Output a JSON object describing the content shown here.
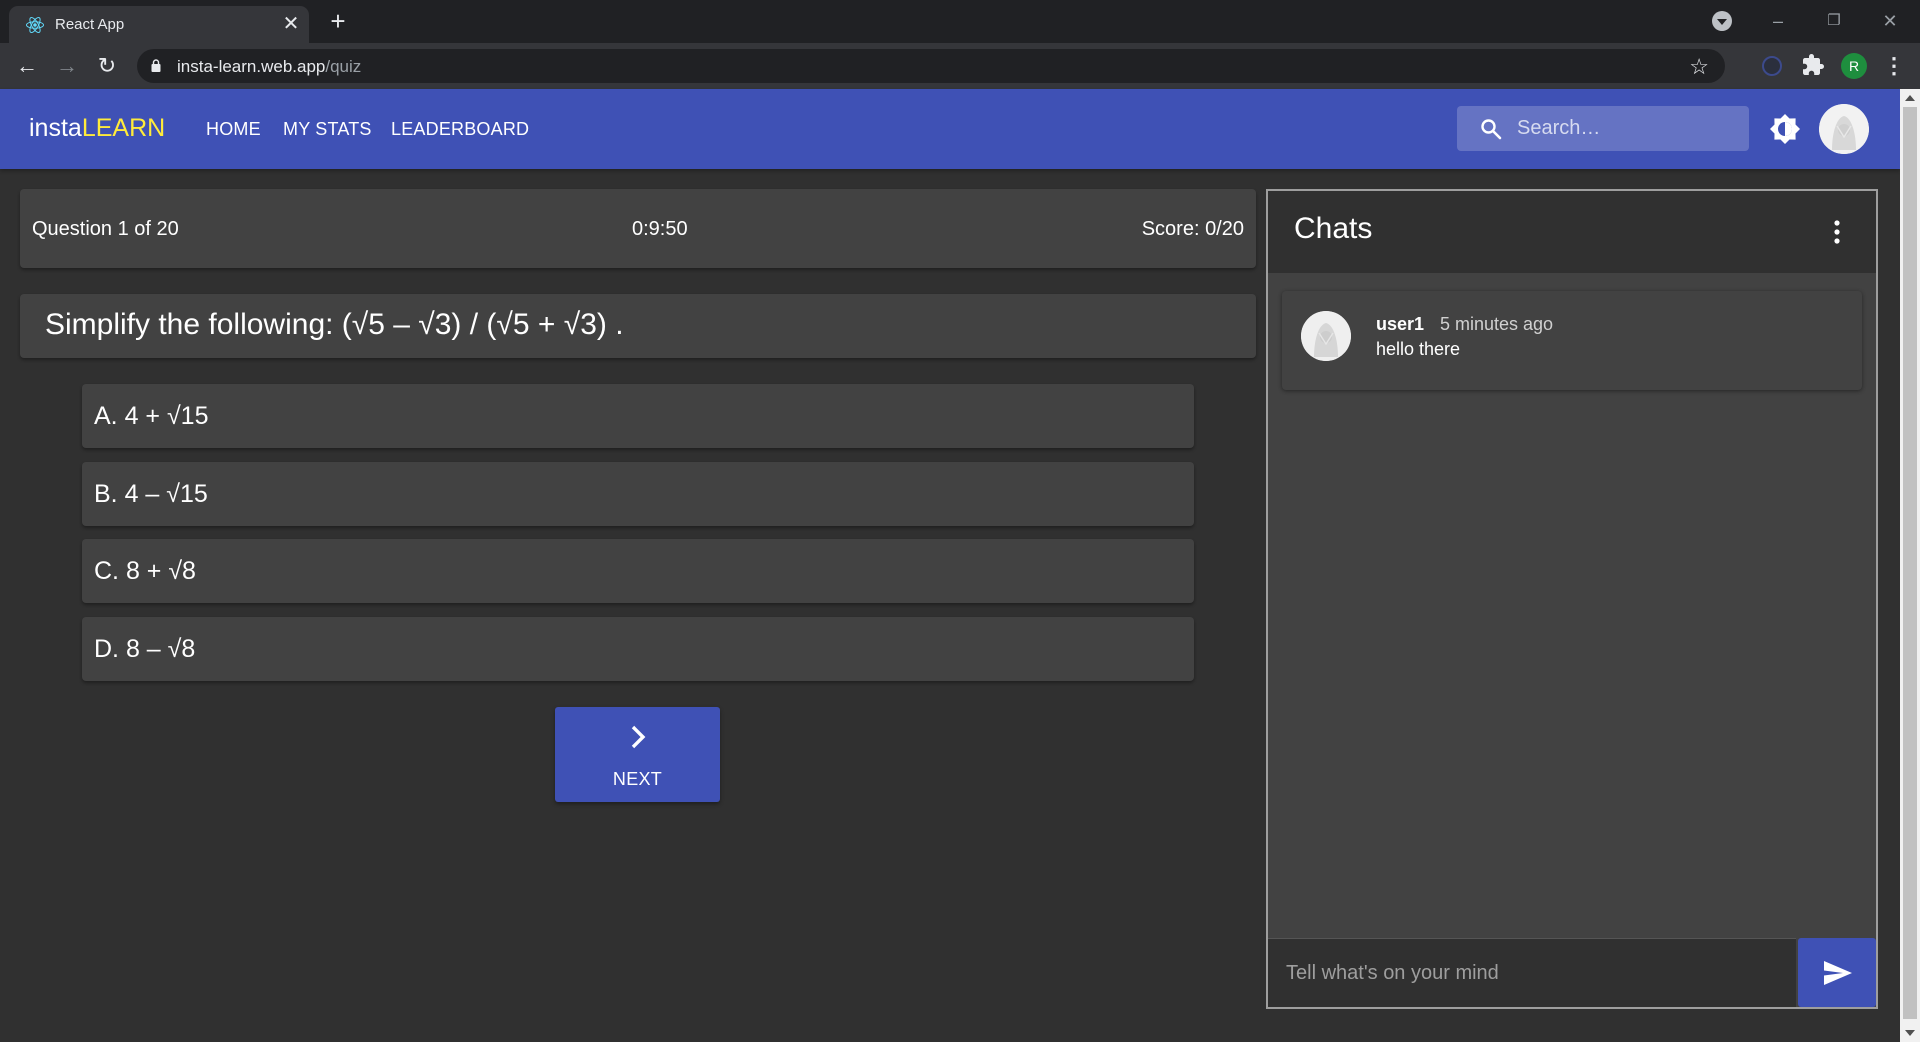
{
  "browser": {
    "tab_title": "React App",
    "url_host": "insta-learn.web.app",
    "url_path": "/quiz",
    "profile_initial": "R"
  },
  "appbar": {
    "brand_prefix": "insta",
    "brand_highlight": "LEARN",
    "nav": [
      "HOME",
      "MY STATS",
      "LEADERBOARD"
    ],
    "search_placeholder": "Search…",
    "brand_color": "#3f51b5",
    "highlight_color": "#ffeb3b"
  },
  "quiz": {
    "progress": "Question 1 of 20",
    "timer": "0:9:50",
    "score": "Score: 0/20",
    "question": "Simplify the following: (√5 – √3) / (√5 + √3) .",
    "options": [
      "A. 4 + √15",
      "B. 4 – √15",
      "C. 8 + √8",
      "D. 8 – √8"
    ],
    "next_label": "NEXT"
  },
  "chats": {
    "title": "Chats",
    "messages": [
      {
        "user": "user1",
        "time": "5 minutes ago",
        "text": "hello there"
      }
    ],
    "input_placeholder": "Tell what's on your mind"
  }
}
